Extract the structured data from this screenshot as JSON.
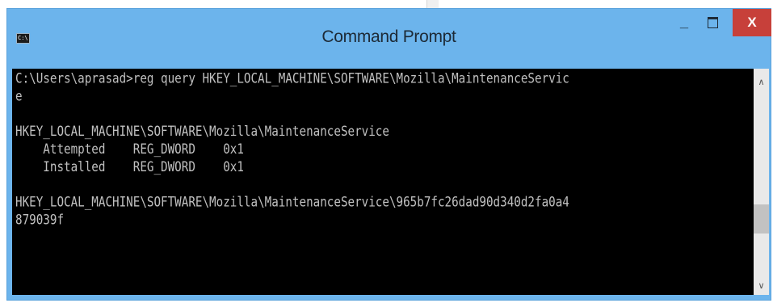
{
  "window": {
    "title": "Command Prompt",
    "icon_label": "C:\\.",
    "icon": "cmd-icon",
    "controls": {
      "minimize_label": "_",
      "minimize_icon": "minimize-icon",
      "maximize_icon": "maximize-icon",
      "close_label": "X",
      "close_icon": "close-icon"
    },
    "colors": {
      "frame": "#6cb4ec",
      "close": "#c7403a",
      "console_bg": "#000000",
      "console_fg": "#c0c0c0"
    }
  },
  "console": {
    "lines": [
      "C:\\Users\\aprasad>reg query HKEY_LOCAL_MACHINE\\SOFTWARE\\Mozilla\\MaintenanceServic",
      "e",
      "",
      "HKEY_LOCAL_MACHINE\\SOFTWARE\\Mozilla\\MaintenanceService",
      "    Attempted    REG_DWORD    0x1",
      "    Installed    REG_DWORD    0x1",
      "",
      "HKEY_LOCAL_MACHINE\\SOFTWARE\\Mozilla\\MaintenanceService\\965b7fc26dad90d340d2fa0a4",
      "879039f"
    ]
  },
  "scrollbar": {
    "up_label": "∧",
    "down_label": "∨"
  }
}
